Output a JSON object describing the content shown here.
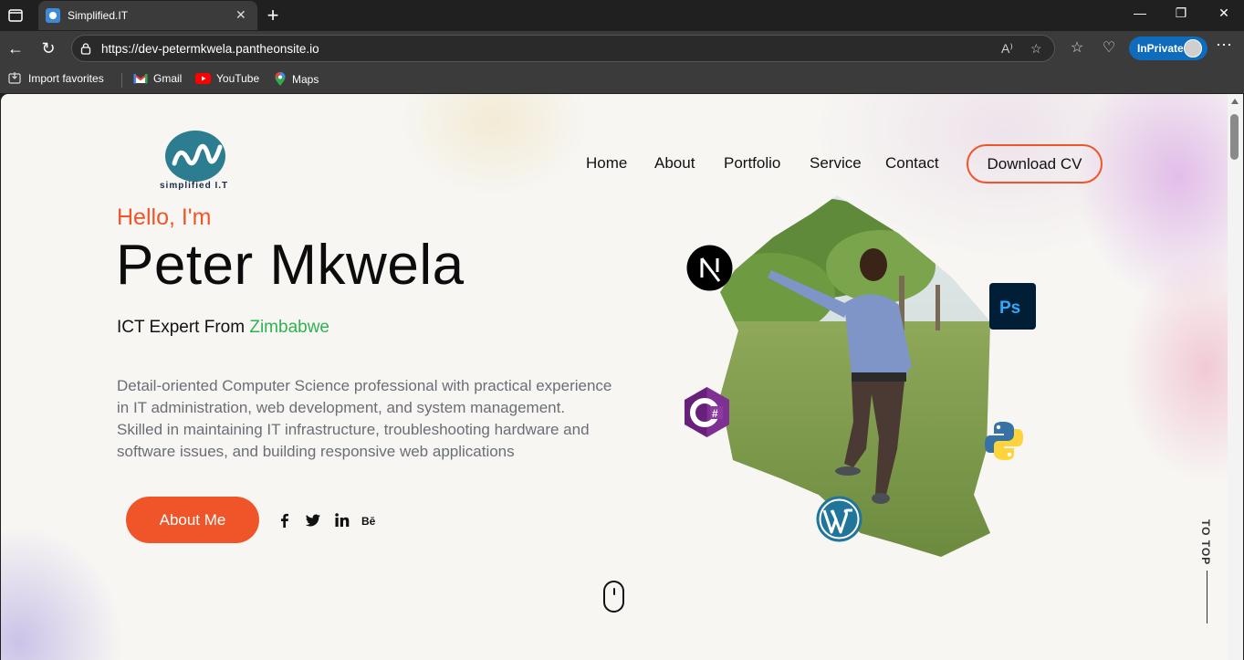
{
  "browser": {
    "tab_title": "Simplified.IT",
    "url": "https://dev-petermkwela.pantheonsite.io",
    "inprivate_label": "InPrivate",
    "favorites": [
      {
        "label": "Import favorites",
        "icon": "import-icon"
      },
      {
        "label": "Gmail",
        "icon": "gmail-icon"
      },
      {
        "label": "YouTube",
        "icon": "youtube-icon"
      },
      {
        "label": "Maps",
        "icon": "maps-icon"
      }
    ]
  },
  "site": {
    "logo_text": "simplified I.T",
    "nav": [
      "Home",
      "About",
      "Portfolio",
      "Service",
      "Contact"
    ],
    "cv_button": "Download CV",
    "hero": {
      "greeting": "Hello, I'm",
      "name": "Peter Mkwela",
      "subtitle_prefix": "ICT Expert From ",
      "subtitle_accent": "Zimbabwe",
      "bio": "Detail-oriented Computer Science professional with practical experience in IT administration, web development, and system management. Skilled in maintaining IT infrastructure, troubleshooting hardware and software issues, and building responsive web applications",
      "about_button": "About Me"
    },
    "social_icons": [
      "facebook-icon",
      "twitter-icon",
      "linkedin-icon",
      "behance-icon"
    ],
    "tech_icons": [
      "nextjs-icon",
      "photoshop-icon",
      "csharp-icon",
      "python-icon",
      "wordpress-icon"
    ],
    "to_top": "TO TOP"
  },
  "colors": {
    "accent": "#f0552a",
    "green": "#2fb34f",
    "inprivate": "#0f6cbd"
  }
}
